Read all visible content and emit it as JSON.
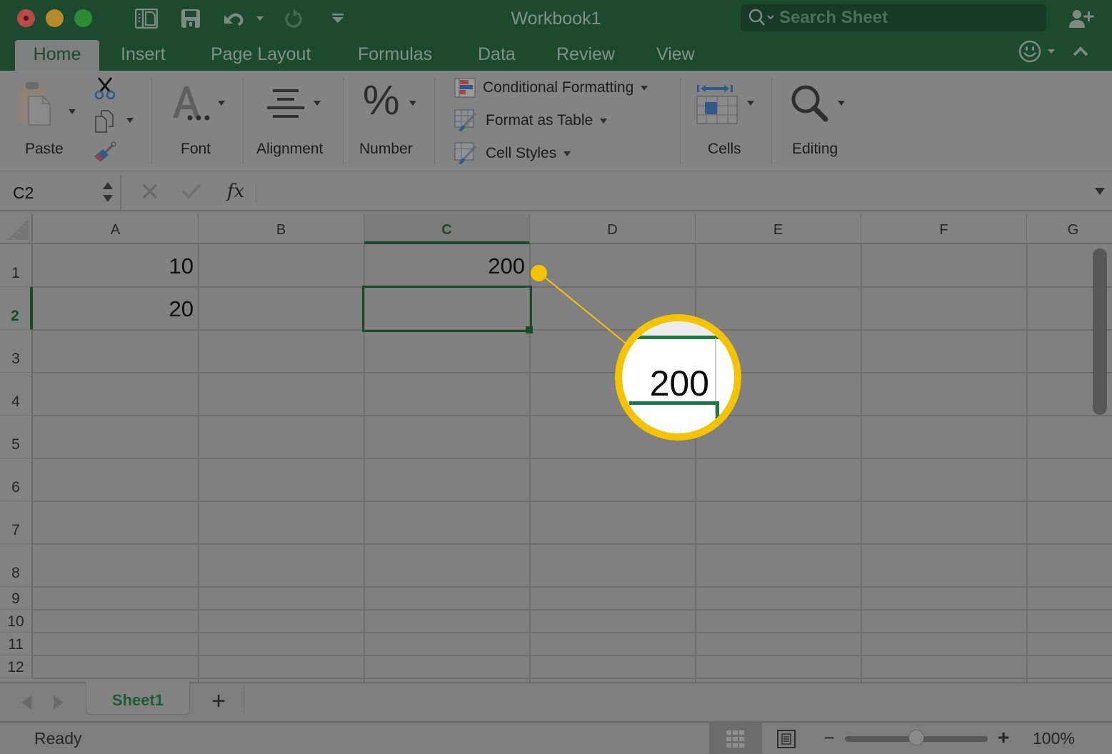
{
  "window": {
    "title": "Workbook1",
    "search_placeholder": "Search Sheet"
  },
  "quick_access": {
    "icons": [
      "sidebar-toggle-icon",
      "save-icon",
      "undo-icon",
      "redo-icon",
      "customize-toolbar-icon"
    ]
  },
  "tabs": [
    {
      "label": "Home",
      "active": true
    },
    {
      "label": "Insert",
      "active": false
    },
    {
      "label": "Page Layout",
      "active": false
    },
    {
      "label": "Formulas",
      "active": false
    },
    {
      "label": "Data",
      "active": false
    },
    {
      "label": "Review",
      "active": false
    },
    {
      "label": "View",
      "active": false
    }
  ],
  "ribbon": {
    "paste_label": "Paste",
    "font_label": "Font",
    "alignment_label": "Alignment",
    "number_label": "Number",
    "conditional_formatting_label": "Conditional Formatting",
    "format_as_table_label": "Format as Table",
    "cell_styles_label": "Cell Styles",
    "cells_label": "Cells",
    "editing_label": "Editing"
  },
  "formula_bar": {
    "name_box": "C2",
    "fx_label": "fx",
    "formula_value": ""
  },
  "sheet": {
    "columns": [
      "A",
      "B",
      "C",
      "D",
      "E",
      "F",
      "G"
    ],
    "selected_column": "C",
    "rows": [
      "1",
      "2",
      "3",
      "4",
      "5",
      "6",
      "7",
      "8",
      "9",
      "10",
      "11",
      "12"
    ],
    "selected_row": "2",
    "selected_cell": "C2",
    "cells": {
      "A1": "10",
      "A2": "20",
      "C1": "200"
    }
  },
  "callout": {
    "magnified_value": "200",
    "color": "#f5c400"
  },
  "sheet_tabs": {
    "tabs": [
      "Sheet1"
    ],
    "active": "Sheet1",
    "add_label": "+"
  },
  "status_bar": {
    "status": "Ready",
    "zoom_label": "100%",
    "zoom_percent": 100
  },
  "colors": {
    "brand_green": "#1d4a2f",
    "selection_green": "#1a4a2e",
    "callout_yellow": "#f5c400"
  }
}
